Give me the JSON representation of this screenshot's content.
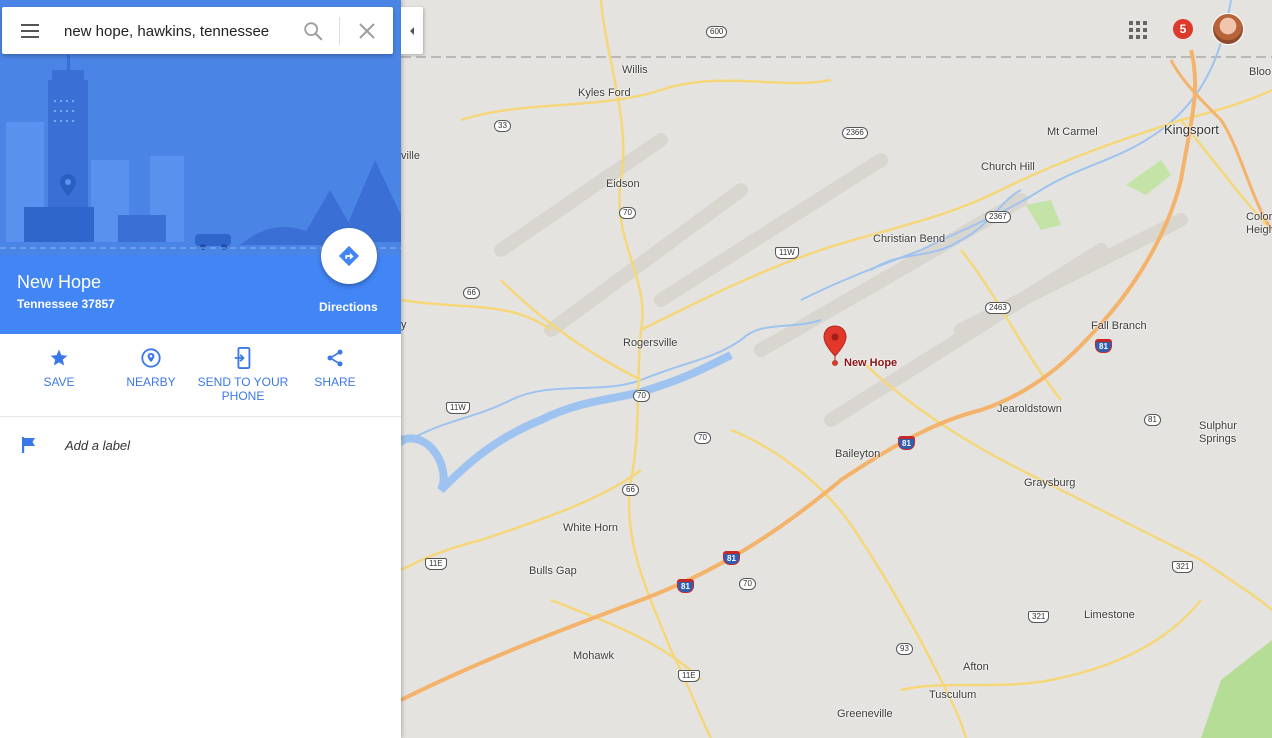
{
  "search": {
    "value": "new hope, hawkins, tennessee"
  },
  "place": {
    "name": "New Hope",
    "address": "Tennessee 37857"
  },
  "directions": {
    "label": "Directions"
  },
  "actions": [
    {
      "label": "SAVE",
      "icon": "star-icon"
    },
    {
      "label": "NEARBY",
      "icon": "nearby-pin-icon"
    },
    {
      "label": "SEND TO YOUR PHONE",
      "icon": "send-to-phone-icon"
    },
    {
      "label": "SHARE",
      "icon": "share-icon"
    }
  ],
  "label_row": {
    "text": "Add a label"
  },
  "notifications": {
    "count": "5"
  },
  "map": {
    "pin_label": "New Hope",
    "places": [
      "Willis",
      "Kyles Ford",
      "ville",
      "Eidson",
      "Mt Carmel",
      "Kingsport",
      "Church Hill",
      "Christian Bend",
      "Fall Branch",
      "Rogersville",
      "Jearoldstown",
      "Baileyton",
      "Sulphur Springs",
      "Graysburg",
      "White Horn",
      "Bulls Gap",
      "Limestone",
      "Mohawk",
      "Afton",
      "Tusculum",
      "Greeneville",
      "Bloo",
      "Color Heigh",
      "y"
    ],
    "routes": [
      "600",
      "33",
      "2366",
      "70",
      "11W",
      "2367",
      "66",
      "2463",
      "81",
      "11E",
      "321",
      "93"
    ]
  },
  "colors": {
    "accent": "#4285f4",
    "action_text": "#3b78e7",
    "pin": "#e2382c"
  }
}
